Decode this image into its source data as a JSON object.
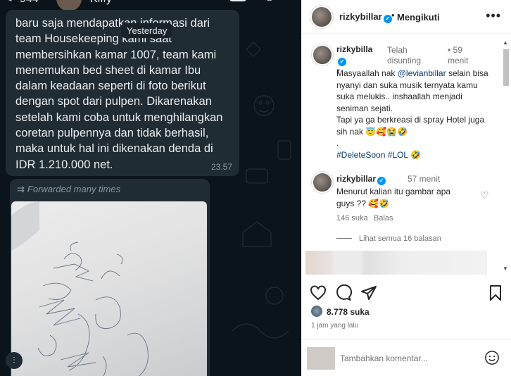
{
  "chat": {
    "back_glyph": "<",
    "count": "944",
    "contact_name": "Kiffy",
    "date_chip": "Yesterday",
    "message1": "baru saja mendapatkan informasi dari\nteam Housekeeping kami saat\nmembersihkan kamar 1007, team kami\nmenemukan bed sheet di kamar Ibu\ndalam keadaan seperti di foto berikut\ndengan spot dari pulpen. Dikarenakan\nsetelah kami coba untuk menghilangkan\ncoretan pulpennya dan tidak berhasil,\nmaka untuk hal ini dikenakan denda di\nIDR 1.210.000 net.",
    "message1_time": "23.57",
    "forwarded_label": "Forwarded many times",
    "forward_icon": "forward-arrows-icon"
  },
  "post": {
    "username": "rizkybillar",
    "separator": "•",
    "follow_state": "Mengikuti",
    "more_glyph": "•••",
    "comments": [
      {
        "username_line1": "rizkybillar",
        "username_line1_short": "rizkybilla",
        "username_line2": "r",
        "edited": "Telah disunting",
        "time_dot": "•",
        "time": "59 menit",
        "body_prefix": "Masyaallah nak ",
        "mention": "@levianbillar",
        "body_rest": " selain bisa nyanyi dan suka musik ternyata kamu suka melukis.. inshaallah menjadi seniman sejati.\nTapi ya ga berkreasi di spray Hotel juga sih nak 😇🥰😭🤣\n.\n",
        "hashtags": "#DeleteSoon #LOL 🤣"
      },
      {
        "username": "rizkybillar",
        "time": "57 menit",
        "body": "Menurut kalian itu gambar apa guys ?? 🥰🤣",
        "likes": "146 suka",
        "reply": "Balas",
        "view_replies": "Lihat semua 16 balasan"
      }
    ],
    "like_count": "8.778 suka",
    "posted_ago": "1 jam yang lalu",
    "comment_placeholder": "Tambahkan komentar..."
  },
  "colors": {
    "chat_bg": "#0b141a",
    "bubble": "#202c33",
    "verified": "#0095f6",
    "mention": "#00376b"
  }
}
